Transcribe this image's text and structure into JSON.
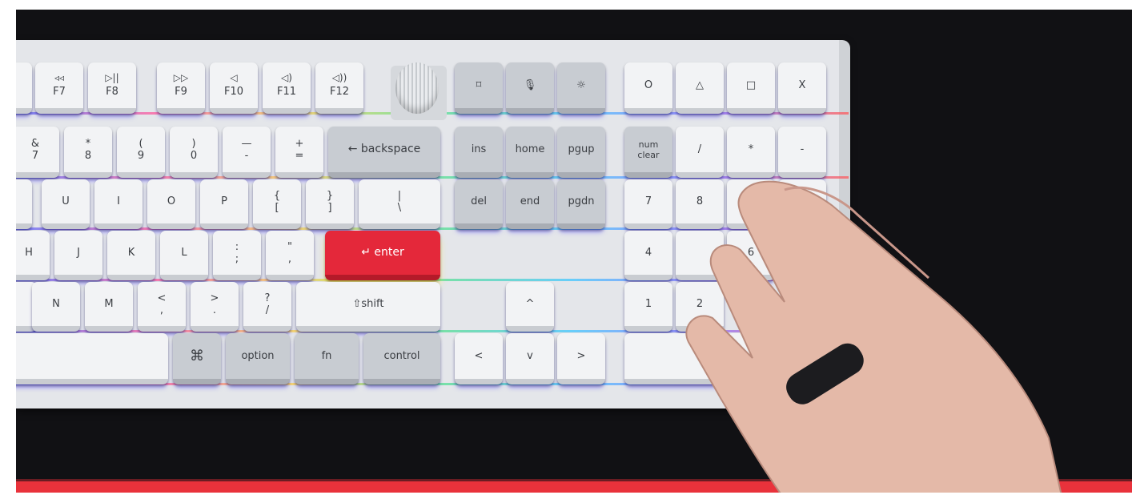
{
  "keyboard": {
    "fn_row": [
      "F7",
      "F8",
      "F9",
      "F10",
      "F11",
      "F12"
    ],
    "fn_icons": [
      "◃◃",
      "▷||",
      "▷▷",
      "◁",
      "◁)",
      "◁))"
    ],
    "row_number": [
      {
        "top": "&",
        "bottom": "7"
      },
      {
        "top": "*",
        "bottom": "8"
      },
      {
        "top": "(",
        "bottom": "9"
      },
      {
        "top": ")",
        "bottom": "0"
      },
      {
        "top": "—",
        "bottom": "-"
      },
      {
        "top": "+",
        "bottom": "="
      }
    ],
    "backspace": "← backspace",
    "row_top": [
      "U",
      "I",
      "O",
      "P"
    ],
    "bracket_open": {
      "top": "{",
      "bottom": "["
    },
    "bracket_close": {
      "top": "}",
      "bottom": "]"
    },
    "backslash": {
      "top": "|",
      "bottom": "\\"
    },
    "row_home": [
      "H",
      "J",
      "K",
      "L"
    ],
    "semicolon": {
      "top": ":",
      "bottom": ";"
    },
    "quote": {
      "top": "\"",
      "bottom": ","
    },
    "enter": "↵ enter",
    "row_bottom": [
      "N",
      "M"
    ],
    "comma": {
      "top": "<",
      "bottom": ","
    },
    "period": {
      "top": ">",
      "bottom": "."
    },
    "slash": {
      "top": "?",
      "bottom": "/"
    },
    "shift": "⇧shift",
    "command": "⌘",
    "option": "option",
    "fn": "fn",
    "control": "control",
    "nav": [
      "ins",
      "home",
      "pgup",
      "del",
      "end",
      "pgdn"
    ],
    "media_icons": [
      "⌑",
      "🎙",
      "☼"
    ],
    "arrows": {
      "up": "^",
      "left": "<",
      "down": "v",
      "right": ">"
    },
    "top_symbols": [
      "O",
      "△",
      "□",
      "X"
    ],
    "numpad": {
      "numclear": "num\nclear",
      "slash": "/",
      "star": "*",
      "minus": "-",
      "seven": "7",
      "eight": "8",
      "four": "4",
      "six": "6",
      "one": "1",
      "two": "2"
    }
  }
}
